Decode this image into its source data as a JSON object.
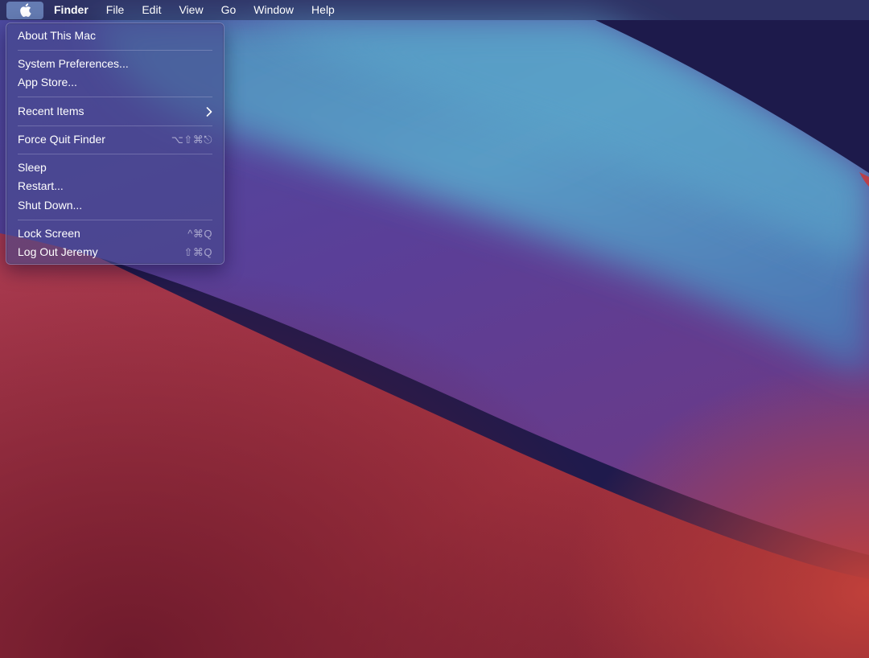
{
  "menubar": {
    "apple_icon": "apple-logo-icon",
    "app_name": "Finder",
    "items": [
      {
        "label": "File"
      },
      {
        "label": "Edit"
      },
      {
        "label": "View"
      },
      {
        "label": "Go"
      },
      {
        "label": "Window"
      },
      {
        "label": "Help"
      }
    ]
  },
  "apple_menu": {
    "items": [
      {
        "label": "About This Mac",
        "shortcut": ""
      },
      {
        "label": "System Preferences...",
        "shortcut": ""
      },
      {
        "label": "App Store...",
        "shortcut": ""
      },
      {
        "label": "Recent Items",
        "shortcut": "",
        "submenu_icon": "chevron-right-icon"
      },
      {
        "label": "Force Quit Finder",
        "shortcut": "⌥⇧⌘⎋"
      },
      {
        "label": "Sleep",
        "shortcut": ""
      },
      {
        "label": "Restart...",
        "shortcut": ""
      },
      {
        "label": "Shut Down...",
        "shortcut": ""
      },
      {
        "label": "Lock Screen",
        "shortcut": "^⌘Q"
      },
      {
        "label": "Log Out Jeremy",
        "shortcut": "⇧⌘Q"
      }
    ]
  },
  "colors": {
    "wallpaper_dark_navy": "#1e1a4a",
    "wallpaper_blue": "#5aa0c8",
    "wallpaper_purple": "#5a3e96",
    "wallpaper_red": "#b83a48",
    "menu_text": "#ffffff"
  }
}
